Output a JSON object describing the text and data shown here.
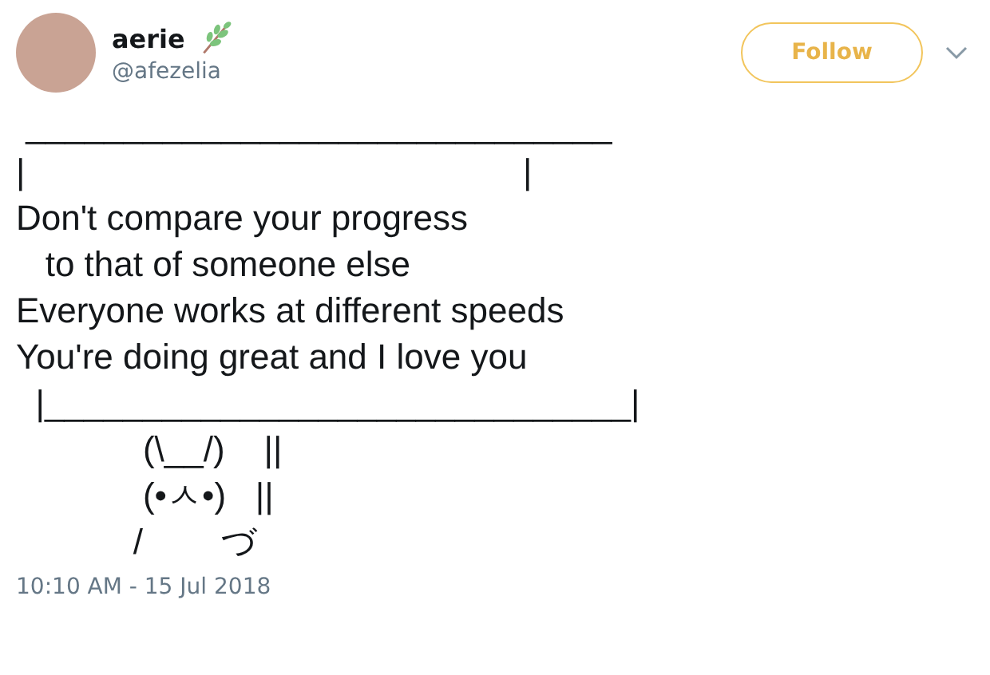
{
  "author": {
    "name": "aerie",
    "handle": "@afezelia"
  },
  "follow_button": {
    "label": "Follow"
  },
  "tweet_text": " ______________________________\n|                                                   |\nDon't compare your progress\n   to that of someone else\nEveryone works at different speeds\nYou're doing great and I love you\n  |______________________________|\n             (\\__/)    ||\n             (•ㅅ•)   ||\n            /        づ",
  "timestamp": "10:10 AM - 15 Jul 2018"
}
